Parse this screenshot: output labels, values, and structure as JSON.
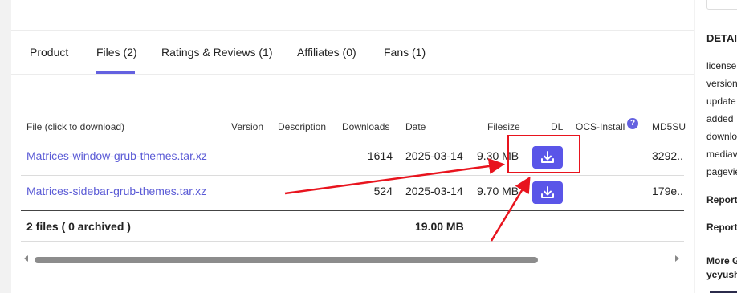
{
  "tabs": [
    {
      "label": "Product"
    },
    {
      "label": "Files (2)",
      "active": true
    },
    {
      "label": "Ratings & Reviews (1)"
    },
    {
      "label": "Affiliates (0)"
    },
    {
      "label": "Fans (1)"
    }
  ],
  "table": {
    "headers": {
      "file": "File (click to download)",
      "version": "Version",
      "description": "Description",
      "downloads": "Downloads",
      "date": "Date",
      "filesize": "Filesize",
      "dl": "DL",
      "ocs": "OCS-Install",
      "md5": "MD5SU"
    },
    "rows": [
      {
        "file": "Matrices-window-grub-themes.tar.xz",
        "version": "",
        "description": "",
        "downloads": "1614",
        "date": "2025-03-14",
        "filesize": "9.30 MB",
        "md5": "3292.."
      },
      {
        "file": "Matrices-sidebar-grub-themes.tar.xz",
        "version": "",
        "description": "",
        "downloads": "524",
        "date": "2025-03-14",
        "filesize": "9.70 MB",
        "md5": "179e.."
      }
    ],
    "footer": {
      "summary": "2 files ( 0 archived )",
      "total": "19.00 MB"
    }
  },
  "help_icon_glyph": "?",
  "right_panel": {
    "heading": "DETAI",
    "lines": [
      "license",
      "version",
      "update",
      "added",
      "downlo",
      "mediav",
      "pagevie"
    ],
    "report1": "Report",
    "report2": "Report",
    "more": "More G",
    "user": "yeyush"
  },
  "colors": {
    "accent": "#6461e0",
    "button": "#5a55e8",
    "annotation": "#e8141e"
  }
}
